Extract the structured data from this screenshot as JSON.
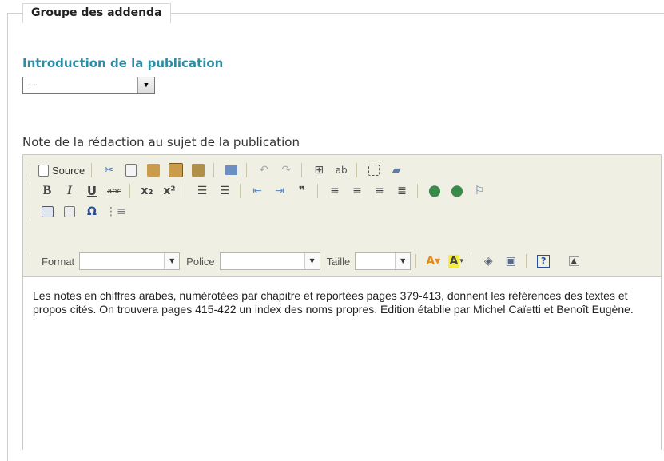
{
  "fieldset": {
    "legend": "Groupe des addenda"
  },
  "introduction": {
    "title": "Introduction de la publication",
    "selected": "--"
  },
  "note": {
    "label": "Note de la rédaction au sujet de la publication",
    "toolbar": {
      "source_label": "Source",
      "format_label": "Format",
      "police_label": "Police",
      "taille_label": "Taille",
      "bold": "B",
      "italic": "I",
      "underline": "U",
      "strike": "abc",
      "subscript": "x₂",
      "superscript": "x²",
      "omega": "Ω",
      "help": "?"
    },
    "content": "Les notes en chiffres arabes, numérotées par chapitre et reportées pages 379-413, donnent les références des textes et propos cités. On trouvera pages 415-422 un index des noms propres. Édition établie par Michel Caïetti et Benoît Eugène."
  }
}
